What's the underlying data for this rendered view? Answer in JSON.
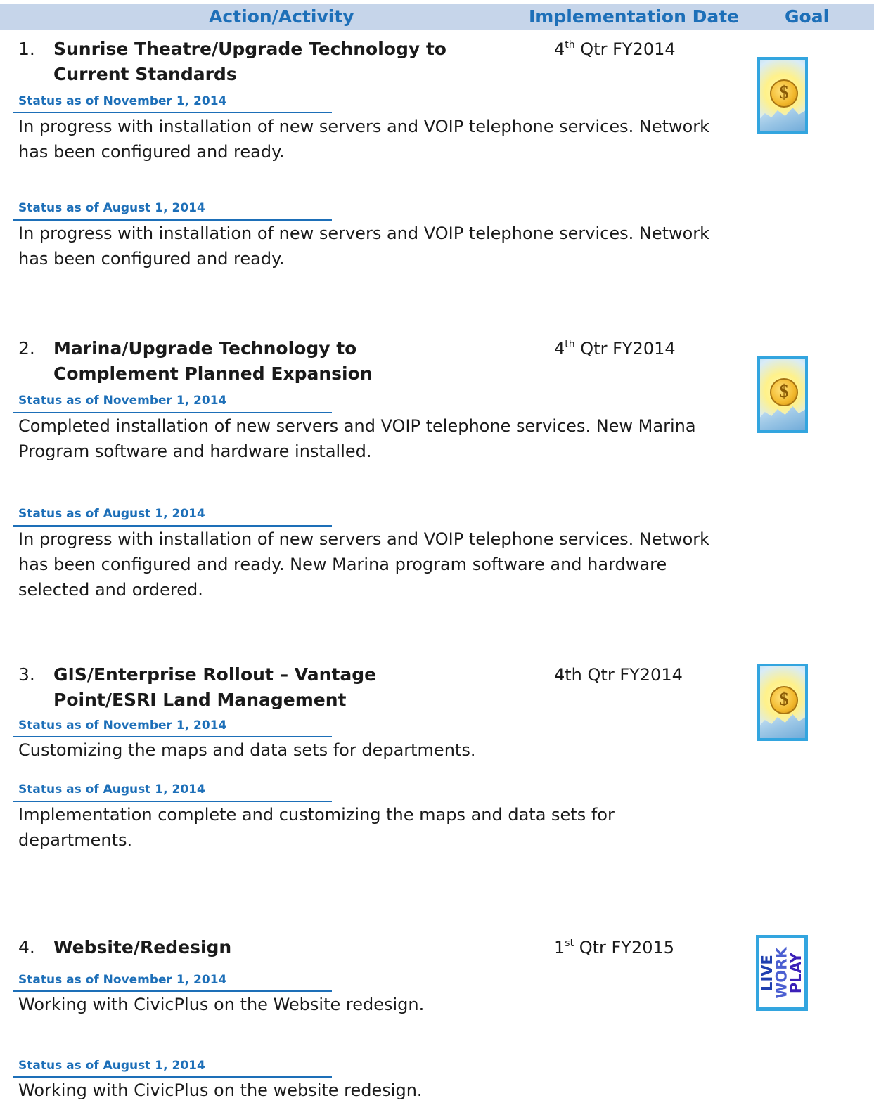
{
  "header": {
    "action": "Action/Activity",
    "date": "Implementation Date",
    "goal": "Goal"
  },
  "items": [
    {
      "number": "1.",
      "title": "Sunrise Theatre/Upgrade Technology to Current Standards",
      "date_prefix": "4",
      "date_sup": "th",
      "date_rest": " Qtr FY2014",
      "goal_icon": "sun-coin-icon",
      "statuses": [
        {
          "label": "Status as of November 1, 2014",
          "text": "In progress with installation of new servers and VOIP telephone services. Network has been configured and ready."
        },
        {
          "label": "Status as of August 1, 2014",
          "text": "In progress with installation of new servers and VOIP telephone services. Network has been configured and ready."
        }
      ]
    },
    {
      "number": "2.",
      "title": "Marina/Upgrade Technology to Complement Planned Expansion",
      "date_prefix": "4",
      "date_sup": "th",
      "date_rest": " Qtr FY2014",
      "goal_icon": "sun-coin-icon",
      "statuses": [
        {
          "label": "Status as of November 1, 2014",
          "text": "Completed installation of new servers and VOIP telephone services.  New Marina Program software and hardware installed."
        },
        {
          "label": "Status as of August 1, 2014",
          "text": "In progress with installation of new servers and VOIP telephone services. Network has been configured and ready.  New Marina program software and hardware selected and ordered."
        }
      ]
    },
    {
      "number": "3.",
      "title": "GIS/Enterprise Rollout – Vantage Point/ESRI Land Management",
      "date_prefix": "4th",
      "date_sup": "",
      "date_rest": " Qtr FY2014",
      "goal_icon": "sun-coin-icon",
      "statuses": [
        {
          "label": "Status as of November 1, 2014",
          "text": "Customizing the maps and data sets for departments."
        },
        {
          "label": "Status as of August 1, 2014",
          "text": "Implementation complete and customizing the maps and data sets for departments."
        }
      ]
    },
    {
      "number": "4.",
      "title": "Website/Redesign",
      "date_prefix": "1",
      "date_sup": "st",
      "date_rest": " Qtr FY2015",
      "goal_icon": "live-work-play-icon",
      "goal_words": [
        "LIVE",
        "WORK",
        "PLAY"
      ],
      "statuses": [
        {
          "label": "Status as of November 1, 2014",
          "text": "Working with CivicPlus on the Website redesign."
        },
        {
          "label": "Status as of August 1, 2014",
          "text": "Working with CivicPlus on the website redesign."
        }
      ]
    }
  ]
}
